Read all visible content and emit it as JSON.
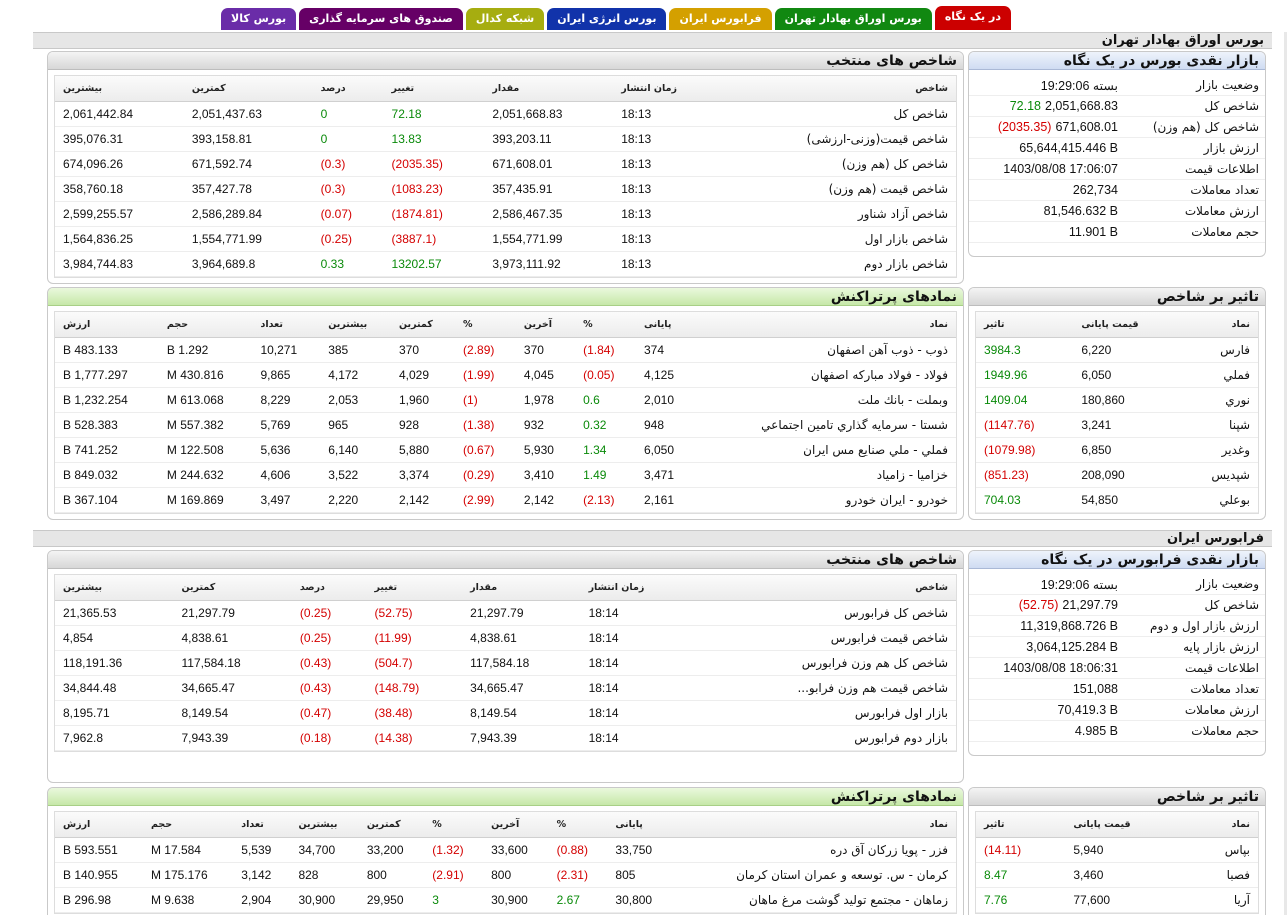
{
  "tabs": [
    {
      "label": "در یک نگاه",
      "color": "#cc0000"
    },
    {
      "label": "بورس اوراق بهادار تهران",
      "color": "#118811"
    },
    {
      "label": "فرابورس ایران",
      "color": "#d4a000"
    },
    {
      "label": "بورس انرژی ایران",
      "color": "#1133aa"
    },
    {
      "label": "شبکه کدال",
      "color": "#a6ad10"
    },
    {
      "label": "صندوق های سرمایه گذاری",
      "color": "#660066"
    },
    {
      "label": "بورس کالا",
      "color": "#6a2ca8"
    }
  ],
  "tse": {
    "title": "بورس اوراق بهادار تهران",
    "market": {
      "title": "بازار نقدی بورس در یک نگاه",
      "rows": [
        {
          "k": "وضعیت بازار",
          "v": "بسته 19:29:06",
          "c": "",
          "cc": ""
        },
        {
          "k": "شاخص کل",
          "v": "2,051,668.83",
          "c": "72.18",
          "cc": "pos"
        },
        {
          "k": "شاخص کل (هم وزن)",
          "v": "671,608.01",
          "c": "(2035.35)",
          "cc": "neg"
        },
        {
          "k": "ارزش بازار",
          "v": "65,644,415.446 B",
          "c": "",
          "cc": ""
        },
        {
          "k": "اطلاعات قیمت",
          "v": "1403/08/08 17:06:07",
          "c": "",
          "cc": ""
        },
        {
          "k": "تعداد معاملات",
          "v": "262,734",
          "c": "",
          "cc": ""
        },
        {
          "k": "ارزش معاملات",
          "v": "81,546.632 B",
          "c": "",
          "cc": ""
        },
        {
          "k": "حجم معاملات",
          "v": "11.901 B",
          "c": "",
          "cc": ""
        }
      ]
    },
    "indices": {
      "title": "شاخص های منتخب",
      "headers": [
        "شاخص",
        "زمان انتشار",
        "مقدار",
        "تغییر",
        "درصد",
        "کمترین",
        "بیشترین"
      ],
      "rows": [
        [
          "شاخص کل",
          "18:13",
          "2,051,668.83",
          "72.18",
          "0",
          "2,051,437.63",
          "2,061,442.84"
        ],
        [
          "شاخص قیمت(وزنی-ارزشی)",
          "18:13",
          "393,203.11",
          "13.83",
          "0",
          "393,158.81",
          "395,076.31"
        ],
        [
          "شاخص کل (هم وزن)",
          "18:13",
          "671,608.01",
          "(2035.35)",
          "(0.3)",
          "671,592.74",
          "674,096.26"
        ],
        [
          "شاخص قیمت (هم وزن)",
          "18:13",
          "357,435.91",
          "(1083.23)",
          "(0.3)",
          "357,427.78",
          "358,760.18"
        ],
        [
          "شاخص آزاد شناور",
          "18:13",
          "2,586,467.35",
          "(1874.81)",
          "(0.07)",
          "2,586,289.84",
          "2,599,255.57"
        ],
        [
          "شاخص بازار اول",
          "18:13",
          "1,554,771.99",
          "(3887.1)",
          "(0.25)",
          "1,554,771.99",
          "1,564,836.25"
        ],
        [
          "شاخص بازار دوم",
          "18:13",
          "3,973,111.92",
          "13202.57",
          "0.33",
          "3,964,689.8",
          "3,984,744.83"
        ]
      ]
    },
    "impact": {
      "title": "تاثیر بر شاخص",
      "headers": [
        "نماد",
        "قیمت پایانی",
        "تاثیر"
      ],
      "rows": [
        [
          "فارس",
          "6,220",
          "3984.3"
        ],
        [
          "فملي",
          "6,050",
          "1949.96"
        ],
        [
          "نوري",
          "180,860",
          "1409.04"
        ],
        [
          "شپنا",
          "3,241",
          "(1147.76)"
        ],
        [
          "وغدير",
          "6,850",
          "(1079.98)"
        ],
        [
          "شپديس",
          "208,090",
          "(851.23)"
        ],
        [
          "بوعلي",
          "54,850",
          "704.03"
        ]
      ]
    },
    "active": {
      "title": "نمادهای پرتراکنش",
      "headers": [
        "نماد",
        "پایانی",
        "%",
        "آخرین",
        "%",
        "کمترین",
        "بیشترین",
        "تعداد",
        "حجم",
        "ارزش"
      ],
      "rows": [
        [
          "ذوب - ذوب آهن اصفهان",
          "374",
          "(1.84)",
          "370",
          "(2.89)",
          "370",
          "385",
          "10,271",
          "1.292 B",
          "483.133 B"
        ],
        [
          "فولاد - فولاد مباركه اصفهان",
          "4,125",
          "(0.05)",
          "4,045",
          "(1.99)",
          "4,029",
          "4,172",
          "9,865",
          "430.816 M",
          "1,777.297 B"
        ],
        [
          "وبملت - بانك ملت",
          "2,010",
          "0.6",
          "1,978",
          "(1)",
          "1,960",
          "2,053",
          "8,229",
          "613.068 M",
          "1,232.254 B"
        ],
        [
          "شستا - سرمايه گذاري تامين اجتماعي",
          "948",
          "0.32",
          "932",
          "(1.38)",
          "928",
          "965",
          "5,769",
          "557.382 M",
          "528.383 B"
        ],
        [
          "فملي - ملي صنايع مس ايران",
          "6,050",
          "1.34",
          "5,930",
          "(0.67)",
          "5,880",
          "6,140",
          "5,636",
          "122.508 M",
          "741.252 B"
        ],
        [
          "خزاميا - زامياد",
          "3,471",
          "1.49",
          "3,410",
          "(0.29)",
          "3,374",
          "3,522",
          "4,606",
          "244.632 M",
          "849.032 B"
        ],
        [
          "خودرو - ايران خودرو",
          "2,161",
          "(2.13)",
          "2,142",
          "(2.99)",
          "2,142",
          "2,220",
          "3,497",
          "169.869 M",
          "367.104 B"
        ]
      ]
    }
  },
  "ifb": {
    "title": "فرابورس ایران",
    "market": {
      "title": "بازار نقدی فرابورس در یک نگاه",
      "rows": [
        {
          "k": "وضعیت بازار",
          "v": "بسته 19:29:06",
          "c": "",
          "cc": ""
        },
        {
          "k": "شاخص کل",
          "v": "21,297.79",
          "c": "(52.75)",
          "cc": "neg"
        },
        {
          "k": "ارزش بازار اول و دوم",
          "v": "11,319,868.726 B",
          "c": "",
          "cc": ""
        },
        {
          "k": "ارزش بازار پایه",
          "v": "3,064,125.284 B",
          "c": "",
          "cc": ""
        },
        {
          "k": "اطلاعات قیمت",
          "v": "1403/08/08 18:06:31",
          "c": "",
          "cc": ""
        },
        {
          "k": "تعداد معاملات",
          "v": "151,088",
          "c": "",
          "cc": ""
        },
        {
          "k": "ارزش معاملات",
          "v": "70,419.3 B",
          "c": "",
          "cc": ""
        },
        {
          "k": "حجم معاملات",
          "v": "4.985 B",
          "c": "",
          "cc": ""
        }
      ]
    },
    "indices": {
      "title": "شاخص های منتخب",
      "headers": [
        "شاخص",
        "زمان انتشار",
        "مقدار",
        "تغییر",
        "درصد",
        "کمترین",
        "بیشترین"
      ],
      "rows": [
        [
          "شاخص كل فرابورس",
          "18:14",
          "21,297.79",
          "(52.75)",
          "(0.25)",
          "21,297.79",
          "21,365.53"
        ],
        [
          "شاخص قیمت فرابورس",
          "18:14",
          "4,838.61",
          "(11.99)",
          "(0.25)",
          "4,838.61",
          "4,854"
        ],
        [
          "شاخص کل هم وزن فرابورس",
          "18:14",
          "117,584.18",
          "(504.7)",
          "(0.43)",
          "117,584.18",
          "118,191.36"
        ],
        [
          "شاخص قیمت هم وزن فرابو...",
          "18:14",
          "34,665.47",
          "(148.79)",
          "(0.43)",
          "34,665.47",
          "34,844.48"
        ],
        [
          "بازار اول فرابورس",
          "18:14",
          "8,149.54",
          "(38.48)",
          "(0.47)",
          "8,149.54",
          "8,195.71"
        ],
        [
          "بازار دوم فرابورس",
          "18:14",
          "7,943.39",
          "(14.38)",
          "(0.18)",
          "7,943.39",
          "7,962.8"
        ]
      ]
    },
    "impact": {
      "title": "تاثیر بر شاخص",
      "headers": [
        "نماد",
        "قیمت پایانی",
        "تاثیر"
      ],
      "rows": [
        [
          "بپاس",
          "5,940",
          "(14.11)"
        ],
        [
          "فصبا",
          "3,460",
          "8.47"
        ],
        [
          "آريا",
          "77,600",
          "7.76"
        ]
      ]
    },
    "active": {
      "title": "نمادهای پرتراکنش",
      "headers": [
        "نماد",
        "پایانی",
        "%",
        "آخرین",
        "%",
        "کمترین",
        "بیشترین",
        "تعداد",
        "حجم",
        "ارزش"
      ],
      "rows": [
        [
          "فزر - پويا زركان آق دره",
          "33,750",
          "(0.88)",
          "33,600",
          "(1.32)",
          "33,200",
          "34,700",
          "5,539",
          "17.584 M",
          "593.551 B"
        ],
        [
          "كرمان - س. توسعه و عمران استان كرمان",
          "805",
          "(2.31)",
          "800",
          "(2.91)",
          "800",
          "828",
          "3,142",
          "175.176 M",
          "140.955 B"
        ],
        [
          "زماهان - مجتمع توليد گوشت مرغ ماهان",
          "30,800",
          "2.67",
          "30,900",
          "3",
          "29,950",
          "30,900",
          "2,904",
          "9.638 M",
          "296.98 B"
        ]
      ]
    }
  }
}
